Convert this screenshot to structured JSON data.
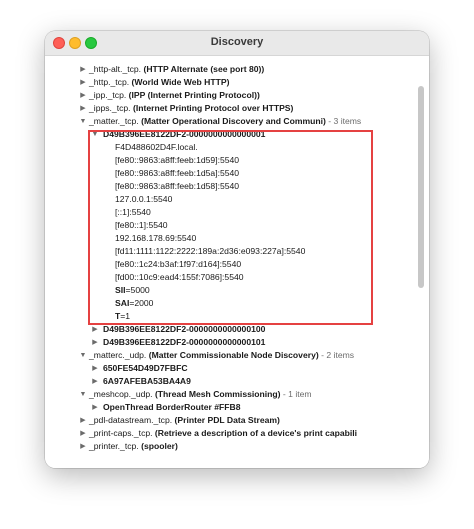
{
  "window": {
    "title": "Discovery",
    "accent_highlight_color": "#e54141"
  },
  "tree": {
    "rows": [
      {
        "prefix": "_http-alt._tcp.",
        "desc": "(HTTP Alternate (see port 80))",
        "count": ""
      },
      {
        "prefix": "_http._tcp.",
        "desc": "(World Wide Web HTTP)",
        "count": ""
      },
      {
        "prefix": "_ipp._tcp.",
        "desc": "(IPP (Internet Printing Protocol))",
        "count": ""
      },
      {
        "prefix": "_ipps._tcp.",
        "desc": "(Internet Printing Protocol over HTTPS)",
        "count": ""
      },
      {
        "prefix": "_matter._tcp.",
        "desc": "(Matter Operational Discovery and Communi)",
        "count": "- 3 items"
      },
      {
        "text": "D49B396EE8122DF2-0000000000000001"
      },
      {
        "text": "F4D488602D4F.local."
      },
      {
        "text": "[fe80::9863:a8ff:feeb:1d59]:5540"
      },
      {
        "text": "[fe80::9863:a8ff:feeb:1d5a]:5540"
      },
      {
        "text": "[fe80::9863:a8ff:feeb:1d58]:5540"
      },
      {
        "text": "127.0.0.1:5540"
      },
      {
        "text": "[::1]:5540"
      },
      {
        "text": "[fe80::1]:5540"
      },
      {
        "text": "192.168.178.69:5540"
      },
      {
        "text": "[fd11:1111:1122:2222:189a:2d36:e093:227a]:5540"
      },
      {
        "text": "[fe80::1c24:b3af:1f97:d164]:5540"
      },
      {
        "text": "[fd00::10c9:ead4:155f:7086]:5540"
      },
      {
        "key": "SII",
        "value": "=5000"
      },
      {
        "key": "SAI",
        "value": "=2000"
      },
      {
        "key": "T",
        "value": "=1"
      },
      {
        "text": "D49B396EE8122DF2-0000000000000100"
      },
      {
        "text": "D49B396EE8122DF2-0000000000000101"
      },
      {
        "prefix": "_matterc._udp.",
        "desc": "(Matter Commissionable Node Discovery)",
        "count": "- 2 items"
      },
      {
        "text": "650FE54D49D7FBFC"
      },
      {
        "text": "6A97AFEBA53BA4A9"
      },
      {
        "prefix": "_meshcop._udp.",
        "desc": "(Thread Mesh Commissioning)",
        "count": "- 1 item"
      },
      {
        "text": "OpenThread BorderRouter #FFB8"
      },
      {
        "prefix": "_pdl-datastream._tcp.",
        "desc": "(Printer PDL Data Stream)",
        "count": ""
      },
      {
        "prefix": "_print-caps._tcp.",
        "desc": "(Retrieve a description of a device's print capabili",
        "count": ""
      },
      {
        "prefix": "_printer._tcp.",
        "desc": "(spooler)",
        "count": ""
      }
    ]
  }
}
